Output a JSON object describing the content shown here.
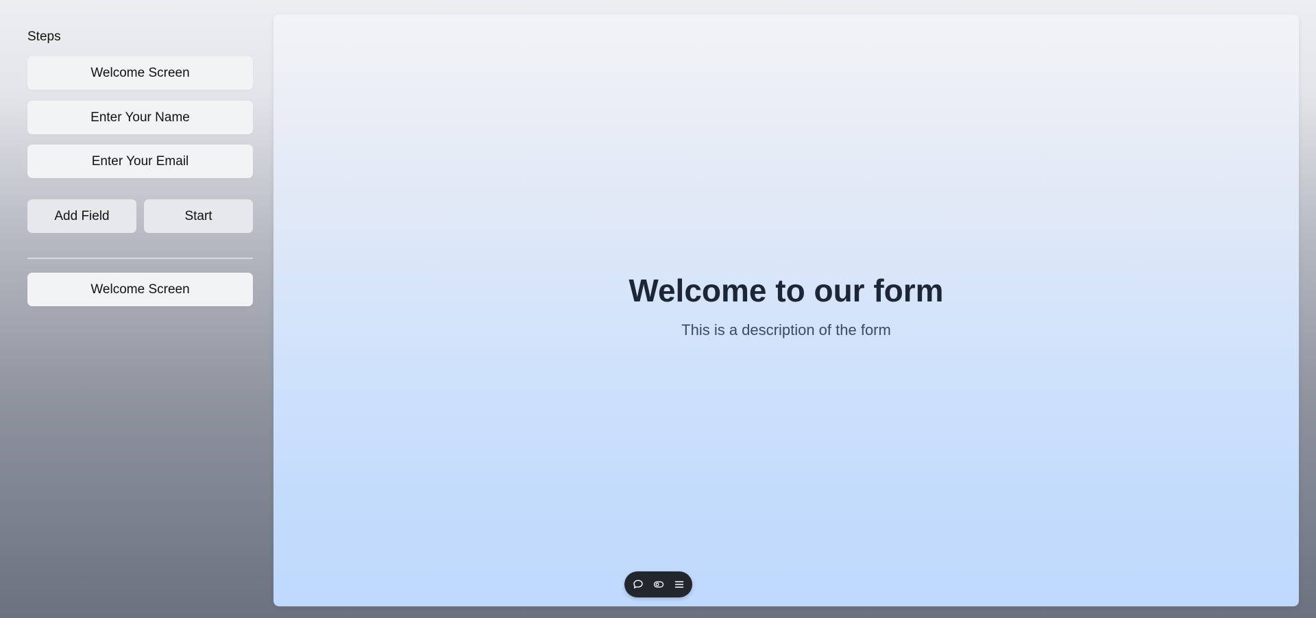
{
  "sidebar": {
    "title": "Steps",
    "steps": [
      {
        "label": "Welcome Screen"
      },
      {
        "label": "Enter Your Name"
      },
      {
        "label": "Enter Your Email"
      }
    ],
    "actions": {
      "add_field": "Add Field",
      "start": "Start"
    },
    "selected_step": {
      "label": "Welcome Screen"
    }
  },
  "preview": {
    "title": "Welcome to our form",
    "description": "This is a description of the form"
  },
  "toolbar": {
    "icons": [
      "comment-icon",
      "toggle-icon",
      "menu-icon"
    ]
  },
  "colors": {
    "preview_gradient_top": "#f2f3f6",
    "preview_gradient_bottom": "#bfd9fd",
    "toolbar_bg": "#22262d",
    "title_color": "#1d2636"
  }
}
